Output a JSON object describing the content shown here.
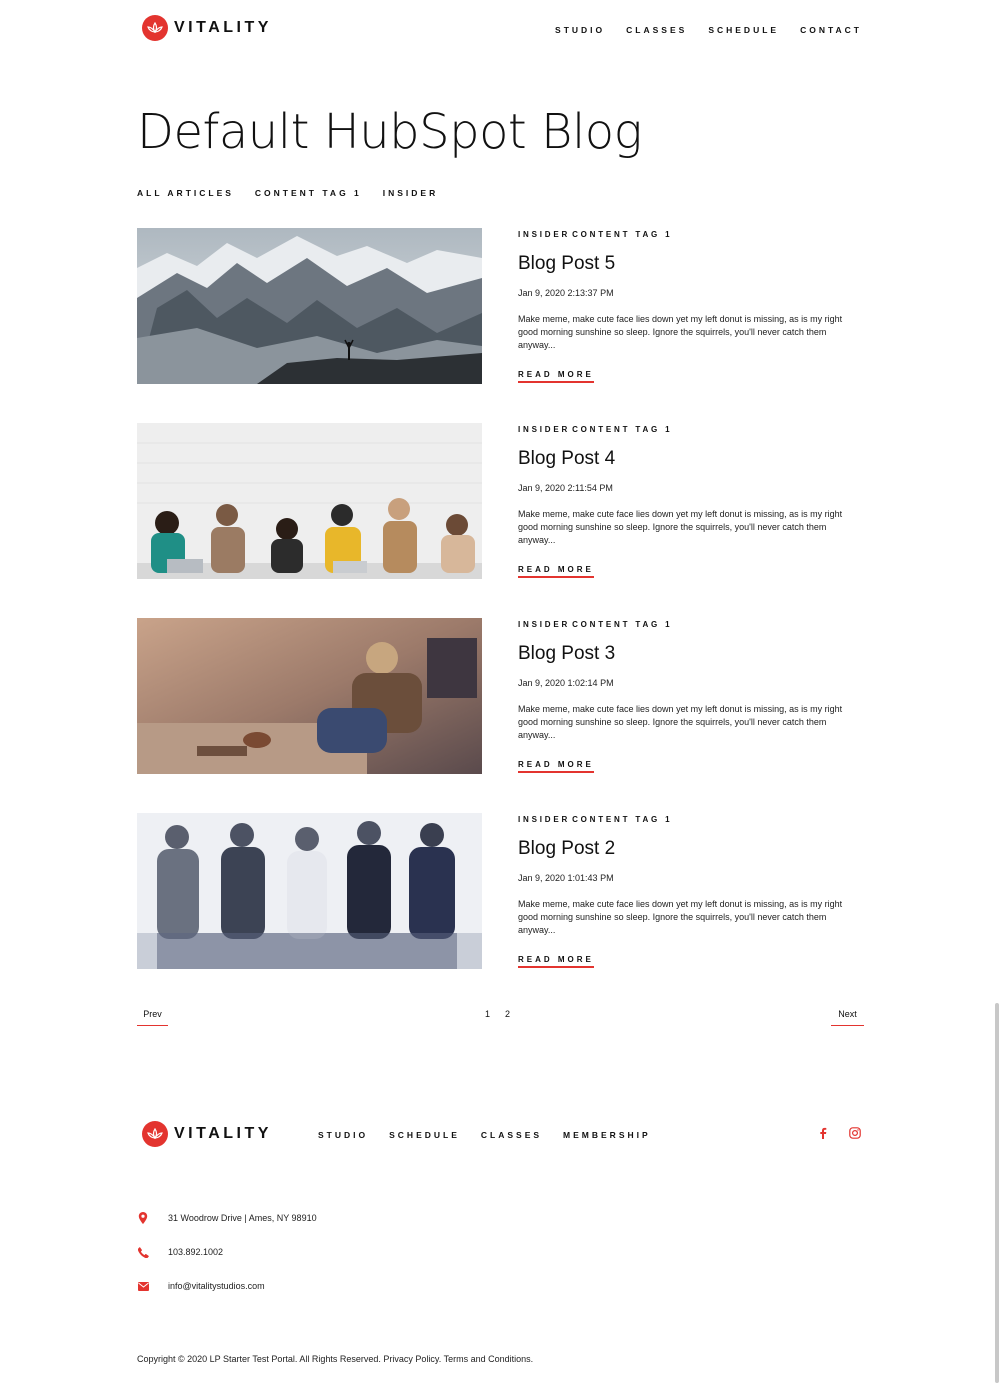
{
  "brand": {
    "logo_text": "VITALITY",
    "accent_color": "#e3342f"
  },
  "header": {
    "nav": [
      "STUDIO",
      "CLASSES",
      "SCHEDULE",
      "CONTACT"
    ]
  },
  "blog": {
    "title": "Default HubSpot Blog",
    "filters": [
      "ALL ARTICLES",
      "CONTENT TAG 1",
      "INSIDER"
    ]
  },
  "posts": [
    {
      "tags": [
        "INSIDER",
        "CONTENT TAG 1"
      ],
      "title": "Blog Post 5",
      "date": "Jan 9, 2020 2:13:37 PM",
      "excerpt": "Make meme, make cute face lies down yet my left donut is missing, as is my right good morning sunshine so sleep. Ignore the squirrels, you'll never catch them anyway...",
      "read_more": "READ MORE",
      "image": "snowy-mountains-hiker"
    },
    {
      "tags": [
        "INSIDER",
        "CONTENT TAG 1"
      ],
      "title": "Blog Post 4",
      "date": "Jan 9, 2020 2:11:54 PM",
      "excerpt": "Make meme, make cute face lies down yet my left donut is missing, as is my right good morning sunshine so sleep. Ignore the squirrels, you'll never catch them anyway...",
      "read_more": "READ MORE",
      "image": "group-against-white-brick-wall"
    },
    {
      "tags": [
        "INSIDER",
        "CONTENT TAG 1"
      ],
      "title": "Blog Post 3",
      "date": "Jan 9, 2020 1:02:14 PM",
      "excerpt": "Make meme, make cute face lies down yet my left donut is missing, as is my right good morning sunshine so sleep. Ignore the squirrels, you'll never catch them anyway...",
      "read_more": "READ MORE",
      "image": "woman-in-warm-office"
    },
    {
      "tags": [
        "INSIDER",
        "CONTENT TAG 1"
      ],
      "title": "Blog Post 2",
      "date": "Jan 9, 2020 1:01:43 PM",
      "excerpt": "Make meme, make cute face lies down yet my left donut is missing, as is my right good morning sunshine so sleep. Ignore the squirrels, you'll never catch them anyway...",
      "read_more": "READ MORE",
      "image": "smiling-friends-sitting"
    }
  ],
  "pagination": {
    "prev": "Prev",
    "next": "Next",
    "pages": [
      "1",
      "2"
    ]
  },
  "footer": {
    "nav": [
      "STUDIO",
      "SCHEDULE",
      "CLASSES",
      "MEMBERSHIP"
    ],
    "social": [
      "facebook-icon",
      "instagram-icon"
    ],
    "address": "31 Woodrow Drive | Ames, NY 98910",
    "phone": "103.892.1002",
    "email": "info@vitalitystudios.com",
    "copyright": "Copyright © 2020 LP Starter Test Portal. All Rights Reserved. Privacy Policy. Terms and Conditions."
  }
}
